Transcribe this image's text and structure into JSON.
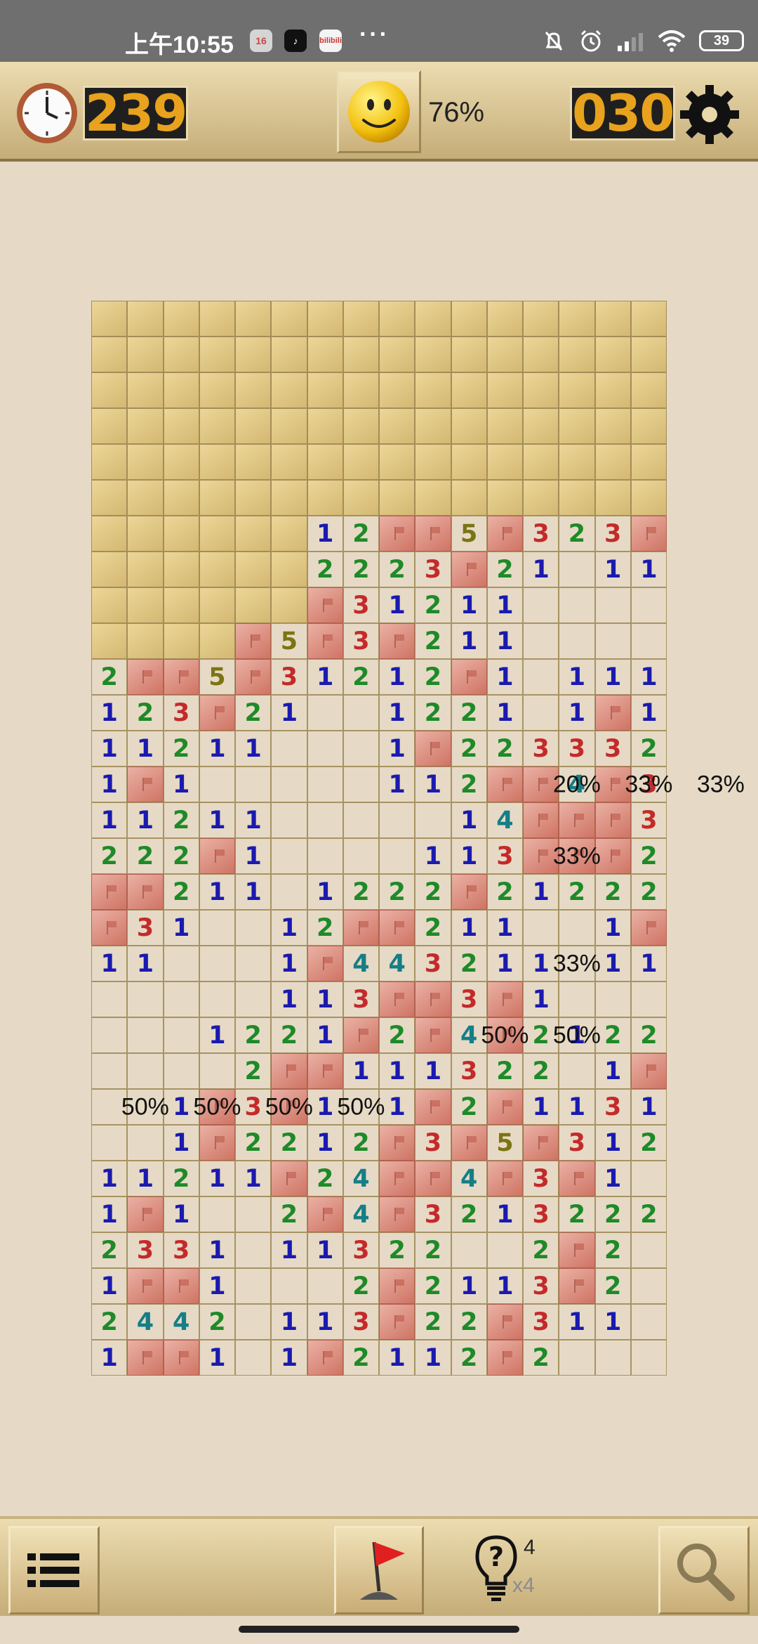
{
  "status_bar": {
    "time": "上午10:55",
    "apps": [
      "16",
      "♪",
      "bilibili"
    ],
    "more": "···",
    "battery": "39"
  },
  "top_bar": {
    "timer": "239",
    "progress": "76%",
    "mines_left": "030",
    "face": "smiley-icon"
  },
  "board": {
    "cols": 16,
    "rows": 30,
    "legend": "H = covered tile, F = flagged tile, '.' = opened blank, digit = adjacent mine count",
    "cells": [
      "HHHHHHHHHHHHHHHH",
      "HHHHHHHHHHHHHHHH",
      "HHHHHHHHHHHHHHHH",
      "HHHHHHHHHHHHHHHH",
      "HHHHHHHHHHHHHHHH",
      "HHHHHHHHHHHHHHHH",
      "HHHHHH12FF5F323F",
      "HHHHHH2223F21.11",
      "HHHHHHF31211....",
      "HHHHF5F3F211....",
      "2FF5F31212F1.111",
      "123F21..1221.1F1",
      "11211...1F22333 2",
      "1F1.....112FF4F3",
      "11211.....14FFF3",
      "222F1....113FF F2",
      "FF211.1222F21222",
      "F31..12FF211..1F",
      "11...1F443211.11",
      ".....113FF3F1...",
      "...1221F2F4F212 2",
      "....2FF111322.1F",
      "..1F3F1.1F2F1131",
      "..1F2212F3F5F3121",
      "11211F24FF4F3F1.",
      "1F1..2F4F3213222",
      "2331.1132 2..2F2",
      "1FF1...2F2113F2.",
      "2442.113F22F311.",
      "1FF1.1F2112F2..."
    ],
    "probabilities": [
      {
        "label": "20%",
        "col": 13,
        "row": 13
      },
      {
        "label": "33%",
        "col": 15,
        "row": 13
      },
      {
        "label": "33%",
        "col": 17,
        "row": 13
      },
      {
        "label": "33%",
        "col": 13,
        "row": 15
      },
      {
        "label": "33%",
        "col": 13,
        "row": 18
      },
      {
        "label": "50%",
        "col": 11,
        "row": 20
      },
      {
        "label": "50%",
        "col": 13,
        "row": 20
      },
      {
        "label": "50%",
        "col": 1,
        "row": 22
      },
      {
        "label": "50%",
        "col": 3,
        "row": 22
      },
      {
        "label": "50%",
        "col": 5,
        "row": 22
      },
      {
        "label": "50%",
        "col": 7,
        "row": 22
      }
    ]
  },
  "bottom_bar": {
    "menu_icon": "list-icon",
    "flag_icon": "flag-mode-icon",
    "hint_count": "4",
    "hint_multiplier": "x4",
    "search_icon": "magnifier-icon"
  }
}
